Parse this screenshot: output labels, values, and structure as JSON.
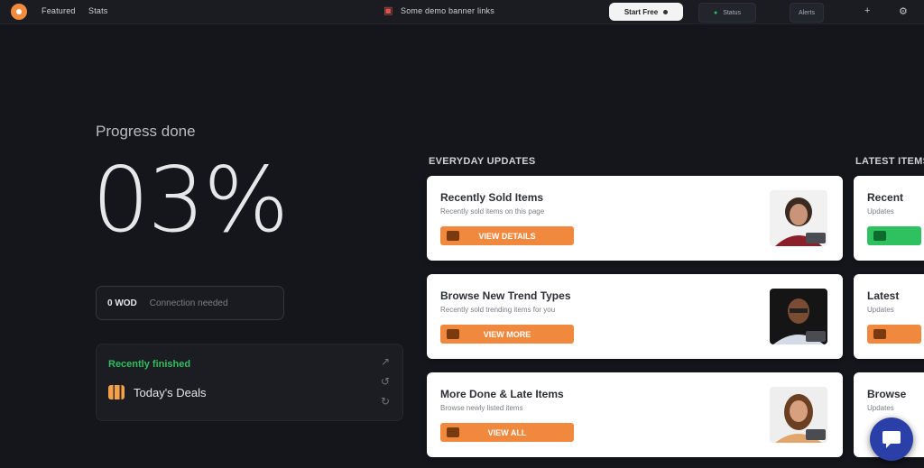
{
  "topbar": {
    "nav_left_1": "Featured",
    "nav_left_2": "Stats",
    "center_link": "Some demo banner links",
    "pill_button": "Start Free",
    "box_1": "Status",
    "box_2": "Alerts",
    "icons": [
      "logo-icon",
      "flag-icon",
      "person-icon",
      "plus-icon",
      "gear-icon"
    ]
  },
  "stat": {
    "label": "Progress done",
    "value": "03%"
  },
  "info_box": {
    "key": "0 WOD",
    "value": "Connection needed"
  },
  "panel": {
    "title": "Recently finished",
    "item_label": "Today's Deals"
  },
  "section_labels": {
    "main": "EVERYDAY UPDATES",
    "side": "LATEST ITEMS"
  },
  "cards": [
    {
      "title": "Recently Sold Items",
      "subtitle": "Recently sold items on this page",
      "button": "VIEW DETAILS"
    },
    {
      "title": "Browse New Trend Types",
      "subtitle": "Recently sold trending items for you",
      "button": "VIEW MORE"
    },
    {
      "title": "More Done & Late Items",
      "subtitle": "Browse newly listed items",
      "button": "VIEW ALL"
    }
  ],
  "side_cards": [
    {
      "title": "Recent",
      "subtitle": "Updates",
      "button": ""
    },
    {
      "title": "Latest",
      "subtitle": "Updates",
      "button": ""
    },
    {
      "title": "Browse",
      "subtitle": "Updates",
      "button": ""
    }
  ],
  "colors": {
    "background": "#14161b",
    "accent_orange": "#f0883e",
    "accent_green": "#2fc05f",
    "fab_blue": "#2b3fa8"
  }
}
